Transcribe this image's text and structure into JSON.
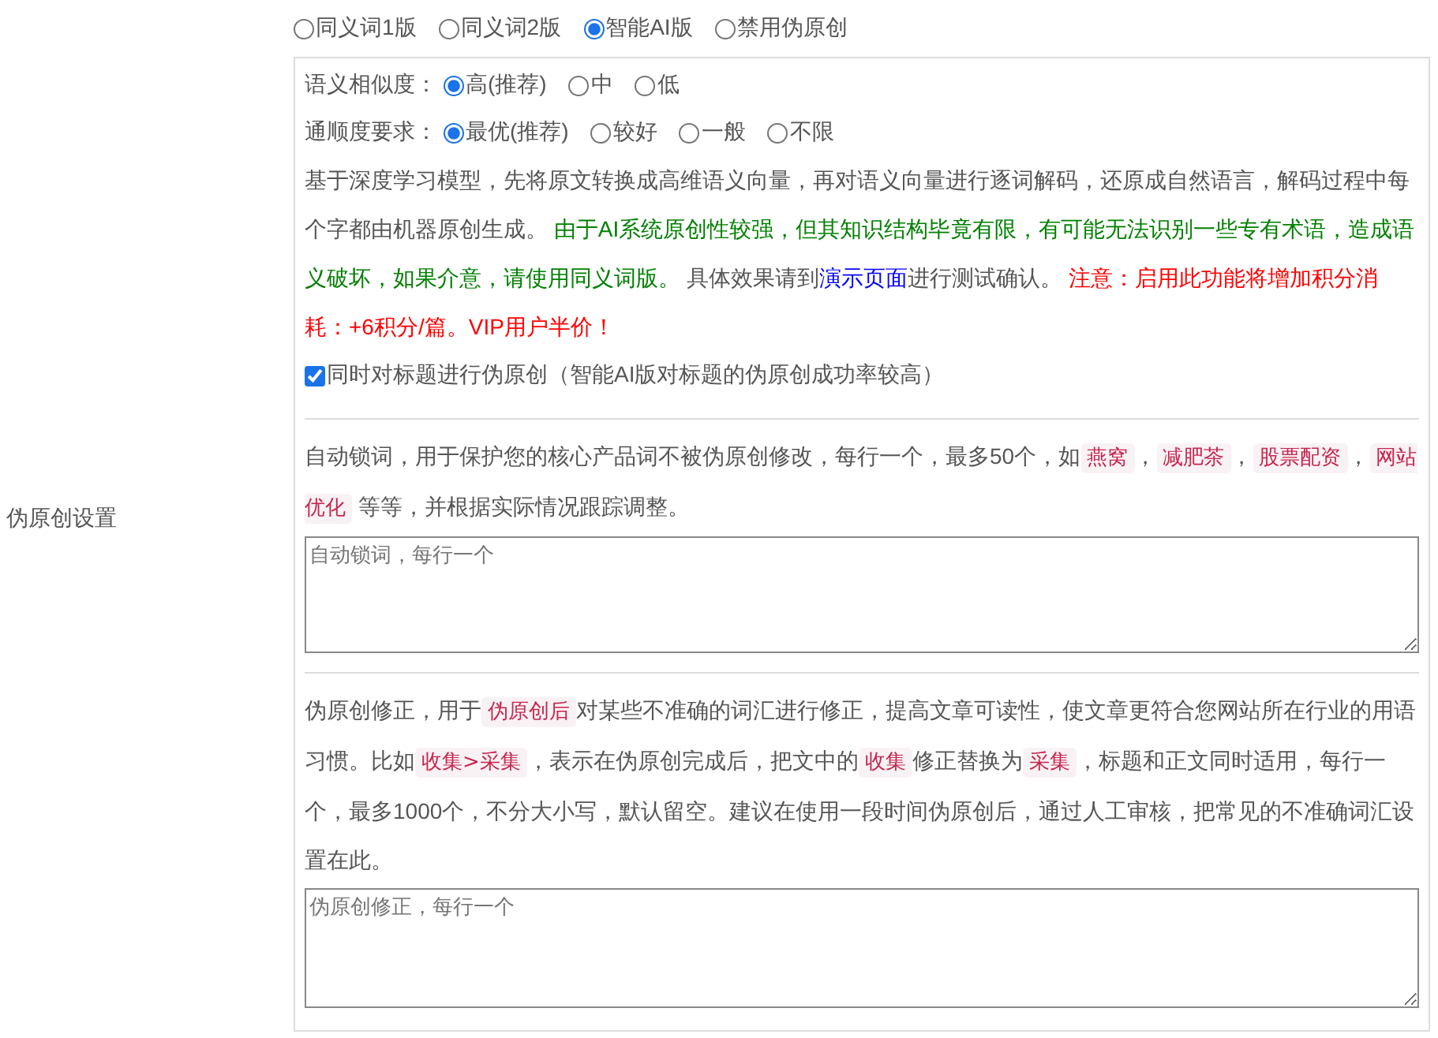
{
  "section_label": "伪原创设置",
  "modes": [
    {
      "label": "同义词1版",
      "selected": false
    },
    {
      "label": "同义词2版",
      "selected": false
    },
    {
      "label": "智能AI版",
      "selected": true
    },
    {
      "label": "禁用伪原创",
      "selected": false
    }
  ],
  "ai_options": [
    {
      "label": "语义相似度：",
      "choices": [
        {
          "label": "高(推荐)",
          "selected": true
        },
        {
          "label": "中",
          "selected": false
        },
        {
          "label": "低",
          "selected": false
        }
      ]
    },
    {
      "label": "通顺度要求：",
      "choices": [
        {
          "label": "最优(推荐)",
          "selected": true
        },
        {
          "label": "较好",
          "selected": false
        },
        {
          "label": "一般",
          "selected": false
        },
        {
          "label": "不限",
          "selected": false
        }
      ]
    }
  ],
  "ai_description": [
    {
      "kind": "text",
      "text": "基于深度学习模型，先将原文转换成高维语义向量，再对语义向量进行逐词解码，还原成自然语言，解码过程中每个字都由机器原创生成。 "
    },
    {
      "kind": "green",
      "text": "由于AI系统原创性较强，但其知识结构毕竟有限，有可能无法识别一些专有术语，造成语义破坏，如果介意，请使用同义词版。"
    },
    {
      "kind": "text",
      "text": " 具体效果请到"
    },
    {
      "kind": "link",
      "text": "演示页面"
    },
    {
      "kind": "text",
      "text": "进行测试确认。 "
    },
    {
      "kind": "red",
      "text": "注意：启用此功能将增加积分消耗：+6积分/篇。VIP用户半价！"
    }
  ],
  "title_option": {
    "label": "同时对标题进行伪原创（智能AI版对标题的伪原创成功率较高）",
    "checked": true
  },
  "lock_description": [
    {
      "kind": "text",
      "text": "自动锁词，用于保护您的核心产品词不被伪原创修改，每行一个，最多50个，如"
    },
    {
      "kind": "code",
      "text": "燕窝"
    },
    {
      "kind": "text",
      "text": "，"
    },
    {
      "kind": "code",
      "text": "减肥茶"
    },
    {
      "kind": "text",
      "text": "，"
    },
    {
      "kind": "code",
      "text": "股票配资"
    },
    {
      "kind": "text",
      "text": "，"
    },
    {
      "kind": "code",
      "text": "网站优化"
    },
    {
      "kind": "text",
      "text": " 等等，并根据实际情况跟踪调整。"
    }
  ],
  "lock_field": {
    "placeholder": "自动锁词，每行一个"
  },
  "fix_description": [
    {
      "kind": "text",
      "text": "伪原创修正，用于"
    },
    {
      "kind": "code",
      "text": "伪原创后"
    },
    {
      "kind": "text",
      "text": "对某些不准确的词汇进行修正，提高文章可读性，使文章更符合您网站所在行业的用语习惯。比如"
    },
    {
      "kind": "code",
      "text": "收集>采集"
    },
    {
      "kind": "text",
      "text": "，表示在伪原创完成后，把文中的"
    },
    {
      "kind": "code",
      "text": "收集"
    },
    {
      "kind": "text",
      "text": "修正替换为"
    },
    {
      "kind": "code",
      "text": "采集"
    },
    {
      "kind": "text",
      "text": "，标题和正文同时适用，每行一个，最多1000个，不分大小写，默认留空。建议在使用一段时间伪原创后，通过人工审核，把常见的不准确词汇设置在此。"
    }
  ],
  "fix_field": {
    "placeholder": "伪原创修正，每行一个"
  }
}
